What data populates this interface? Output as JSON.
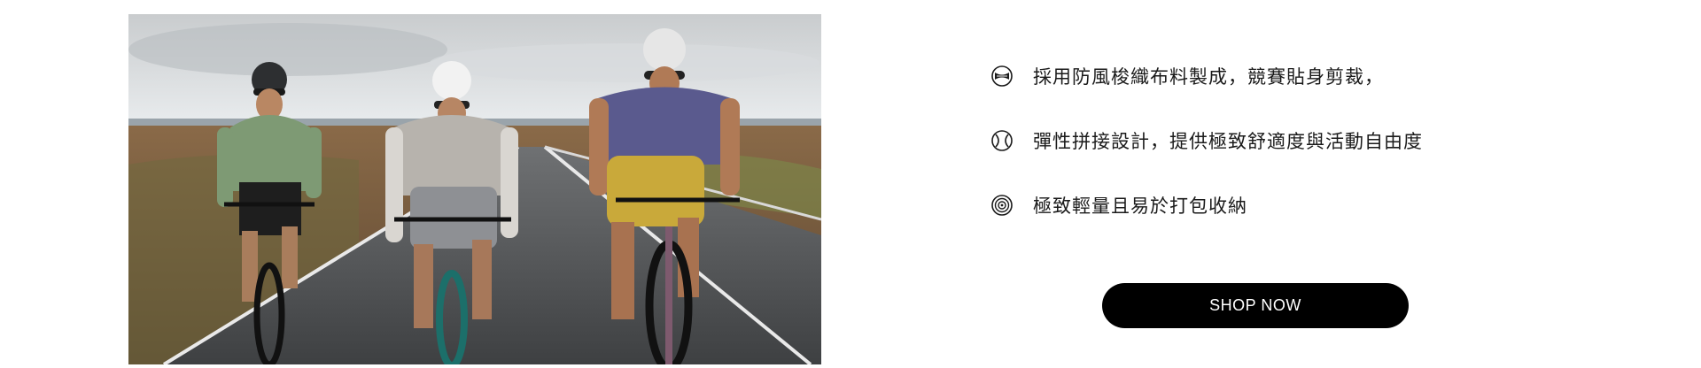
{
  "features": [
    {
      "icon": "fabric-icon",
      "label": "採用防風梭織布料製成，競賽貼身剪裁，"
    },
    {
      "icon": "stretch-ball-icon",
      "label": "彈性拼接設計，提供極致舒適度與活動自由度"
    },
    {
      "icon": "spiral-icon",
      "label": "極致輕量且易於打包收納"
    }
  ],
  "cta": {
    "label": "SHOP NOW"
  },
  "colors": {
    "button_bg": "#000000",
    "button_text": "#ffffff",
    "text": "#1a1a1a"
  }
}
